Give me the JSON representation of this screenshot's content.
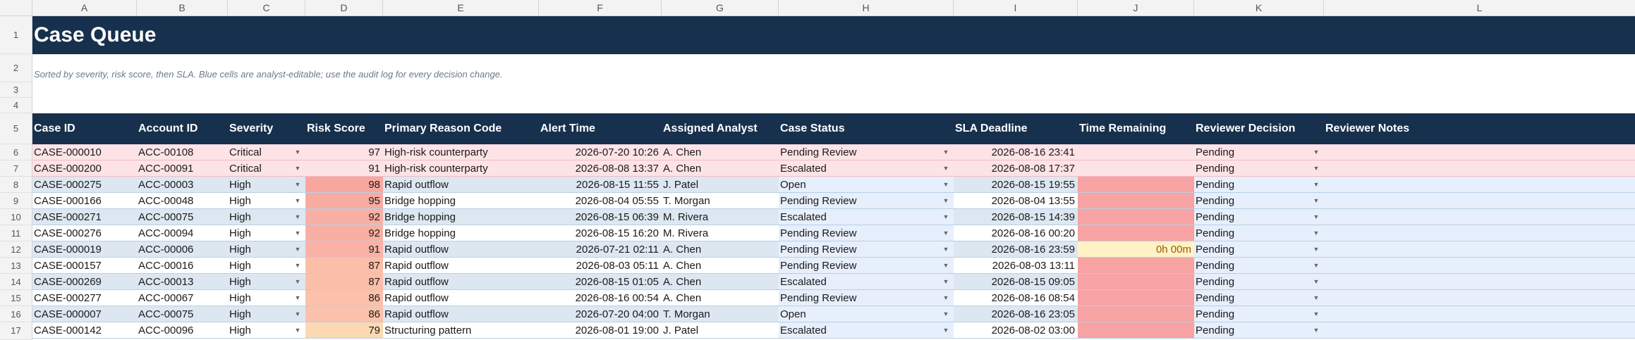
{
  "columns": [
    "A",
    "B",
    "C",
    "D",
    "E",
    "F",
    "G",
    "H",
    "I",
    "J",
    "K",
    "L"
  ],
  "row_numbers": [
    "1",
    "2",
    "3",
    "4",
    "5",
    "6",
    "7",
    "8",
    "9",
    "10",
    "11",
    "12",
    "13",
    "14",
    "15",
    "16",
    "17"
  ],
  "title": "Case Queue",
  "subtitle": "Sorted by severity, risk score, then SLA. Blue cells are analyst-editable; use the audit log for every decision change.",
  "headers": [
    "Case ID",
    "Account ID",
    "Severity",
    "Risk Score",
    "Primary Reason Code",
    "Alert Time",
    "Assigned Analyst",
    "Case Status",
    "SLA Deadline",
    "Time Remaining",
    "Reviewer Decision",
    "Reviewer Notes"
  ],
  "colors": {
    "header_bg": "#17304d",
    "critical_row": "#fde3e6",
    "high_row_a": "#dde7f2",
    "high_row_b": "#ffffff",
    "editable": "#e6effb",
    "overdue": "#f7a2a3",
    "warning": "#fff2c6",
    "warning_text": "#9a5a00"
  },
  "rows": [
    {
      "case_id": "CASE-000010",
      "account_id": "ACC-00108",
      "severity": "Critical",
      "risk_score": "97",
      "reason": "High-risk counterparty",
      "alert_time": "2026-07-20 10:26",
      "analyst": "A. Chen",
      "status": "Pending Review",
      "sla": "2026-08-16 23:41",
      "remaining": "",
      "decision": "Pending",
      "notes": "",
      "risk_color": "",
      "remaining_state": "none",
      "band": "critical"
    },
    {
      "case_id": "CASE-000200",
      "account_id": "ACC-00091",
      "severity": "Critical",
      "risk_score": "91",
      "reason": "High-risk counterparty",
      "alert_time": "2026-08-08 13:37",
      "analyst": "A. Chen",
      "status": "Escalated",
      "sla": "2026-08-08 17:37",
      "remaining": "",
      "decision": "Pending",
      "notes": "",
      "risk_color": "",
      "remaining_state": "none",
      "band": "critical"
    },
    {
      "case_id": "CASE-000275",
      "account_id": "ACC-00003",
      "severity": "High",
      "risk_score": "98",
      "reason": "Rapid outflow",
      "alert_time": "2026-08-15 11:55",
      "analyst": "J. Patel",
      "status": "Open",
      "sla": "2026-08-15 19:55",
      "remaining": "",
      "decision": "Pending",
      "notes": "",
      "risk_color": "#f8a79f",
      "remaining_state": "overdue",
      "band": "a"
    },
    {
      "case_id": "CASE-000166",
      "account_id": "ACC-00048",
      "severity": "High",
      "risk_score": "95",
      "reason": "Bridge hopping",
      "alert_time": "2026-08-04 05:55",
      "analyst": "T. Morgan",
      "status": "Pending Review",
      "sla": "2026-08-04 13:55",
      "remaining": "",
      "decision": "Pending",
      "notes": "",
      "risk_color": "#f8aba1",
      "remaining_state": "overdue",
      "band": "b"
    },
    {
      "case_id": "CASE-000271",
      "account_id": "ACC-00075",
      "severity": "High",
      "risk_score": "92",
      "reason": "Bridge hopping",
      "alert_time": "2026-08-15 06:39",
      "analyst": "M. Rivera",
      "status": "Escalated",
      "sla": "2026-08-15 14:39",
      "remaining": "",
      "decision": "Pending",
      "notes": "",
      "risk_color": "#f9b0a4",
      "remaining_state": "overdue",
      "band": "a"
    },
    {
      "case_id": "CASE-000276",
      "account_id": "ACC-00094",
      "severity": "High",
      "risk_score": "92",
      "reason": "Bridge hopping",
      "alert_time": "2026-08-15 16:20",
      "analyst": "M. Rivera",
      "status": "Pending Review",
      "sla": "2026-08-16 00:20",
      "remaining": "",
      "decision": "Pending",
      "notes": "",
      "risk_color": "#f9b0a4",
      "remaining_state": "overdue",
      "band": "b"
    },
    {
      "case_id": "CASE-000019",
      "account_id": "ACC-00006",
      "severity": "High",
      "risk_score": "91",
      "reason": "Rapid outflow",
      "alert_time": "2026-07-21 02:11",
      "analyst": "A. Chen",
      "status": "Pending Review",
      "sla": "2026-08-16 23:59",
      "remaining": "0h 00m",
      "decision": "Pending",
      "notes": "",
      "risk_color": "#f9b2a5",
      "remaining_state": "warning",
      "band": "a"
    },
    {
      "case_id": "CASE-000157",
      "account_id": "ACC-00016",
      "severity": "High",
      "risk_score": "87",
      "reason": "Rapid outflow",
      "alert_time": "2026-08-03 05:11",
      "analyst": "A. Chen",
      "status": "Pending Review",
      "sla": "2026-08-03 13:11",
      "remaining": "",
      "decision": "Pending",
      "notes": "",
      "risk_color": "#fbbea9",
      "remaining_state": "overdue",
      "band": "b"
    },
    {
      "case_id": "CASE-000269",
      "account_id": "ACC-00013",
      "severity": "High",
      "risk_score": "87",
      "reason": "Rapid outflow",
      "alert_time": "2026-08-15 01:05",
      "analyst": "A. Chen",
      "status": "Escalated",
      "sla": "2026-08-15 09:05",
      "remaining": "",
      "decision": "Pending",
      "notes": "",
      "risk_color": "#fbbea9",
      "remaining_state": "overdue",
      "band": "a"
    },
    {
      "case_id": "CASE-000277",
      "account_id": "ACC-00067",
      "severity": "High",
      "risk_score": "86",
      "reason": "Rapid outflow",
      "alert_time": "2026-08-16 00:54",
      "analyst": "A. Chen",
      "status": "Pending Review",
      "sla": "2026-08-16 08:54",
      "remaining": "",
      "decision": "Pending",
      "notes": "",
      "risk_color": "#fbc1aa",
      "remaining_state": "overdue",
      "band": "b"
    },
    {
      "case_id": "CASE-000007",
      "account_id": "ACC-00075",
      "severity": "High",
      "risk_score": "86",
      "reason": "Rapid outflow",
      "alert_time": "2026-07-20 04:00",
      "analyst": "T. Morgan",
      "status": "Open",
      "sla": "2026-08-16 23:05",
      "remaining": "",
      "decision": "Pending",
      "notes": "",
      "risk_color": "#fbc1aa",
      "remaining_state": "overdue",
      "band": "a"
    },
    {
      "case_id": "CASE-000142",
      "account_id": "ACC-00096",
      "severity": "High",
      "risk_score": "79",
      "reason": "Structuring pattern",
      "alert_time": "2026-08-01 19:00",
      "analyst": "J. Patel",
      "status": "Escalated",
      "sla": "2026-08-02 03:00",
      "remaining": "",
      "decision": "Pending",
      "notes": "",
      "risk_color": "#fcd9b1",
      "remaining_state": "overdue",
      "band": "b"
    }
  ]
}
